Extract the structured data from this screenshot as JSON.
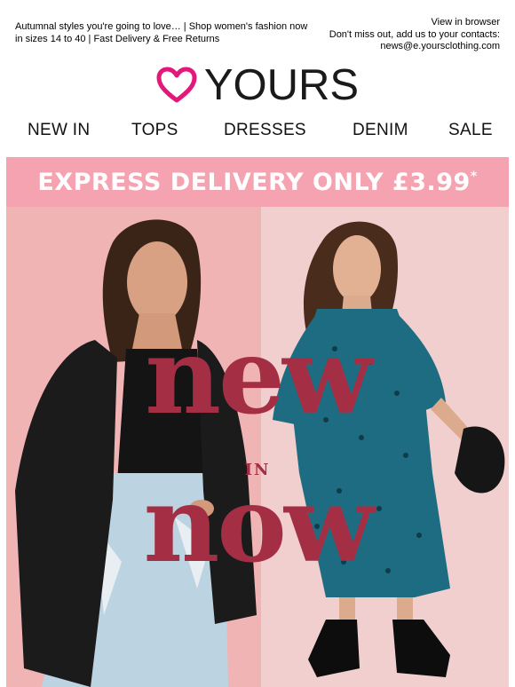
{
  "preheader": {
    "text": "Autumnal styles you're going to love… | Shop women's fashion now in sizes 14 to 40 | Fast Delivery & Free Returns",
    "view_in_browser": "View in browser",
    "contacts_line": "Don't miss out, add us to your contacts:",
    "email": "news@e.yoursclothing.com"
  },
  "logo": {
    "word": "YOURS",
    "heart_color": "#e2197a"
  },
  "nav": {
    "items": [
      "NEW IN",
      "TOPS",
      "DRESSES",
      "DENIM",
      "SALE"
    ]
  },
  "banner": {
    "text": "EXPRESS DELIVERY ONLY £3.99",
    "star": "*",
    "bg_color": "#f5a3b0"
  },
  "hero": {
    "headline_top": "new",
    "headline_mid": "IN",
    "headline_bottom": "now",
    "headline_color": "#a42f45",
    "left_bg": "#f1b4b4",
    "right_bg": "#f2cfcf"
  }
}
